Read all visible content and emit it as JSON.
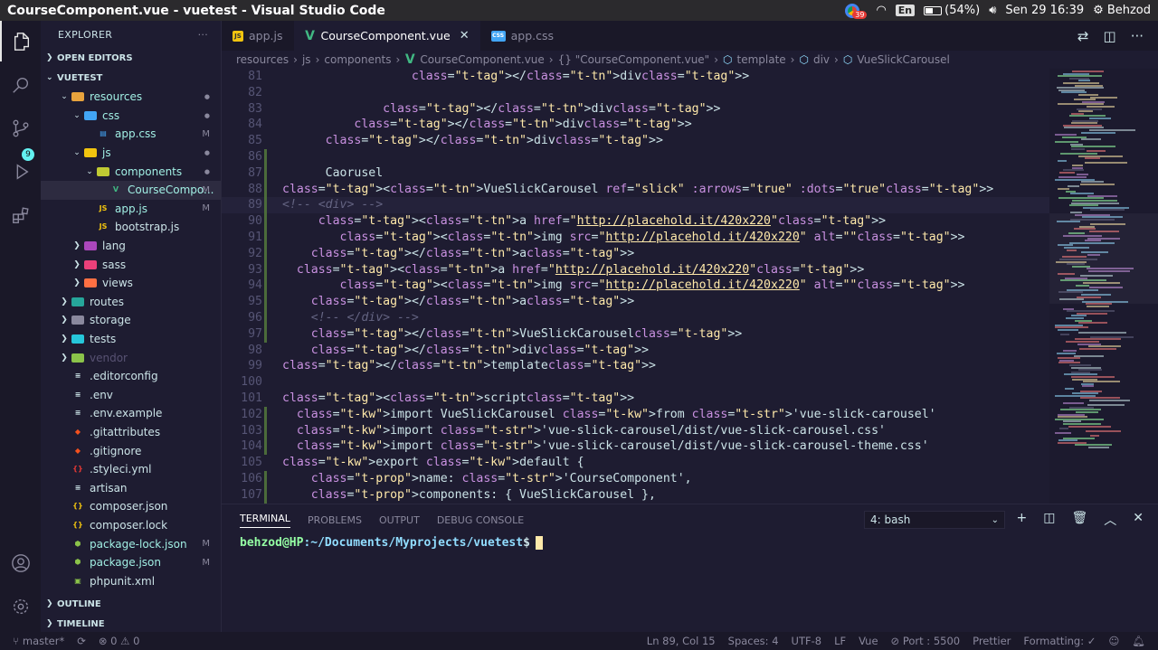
{
  "window": {
    "title": "CourseComponent.vue - vuetest - Visual Studio Code"
  },
  "system": {
    "notification_count": "39",
    "lang": "En",
    "battery": "(54%)",
    "battery_level": 0.54,
    "datetime": "Sen 29 16:39",
    "user": "Behzod"
  },
  "activity": {
    "scm_badge": "9"
  },
  "sidebar": {
    "header": "EXPLORER",
    "open_editors": "OPEN EDITORS",
    "project": "VUETEST",
    "outline": "OUTLINE",
    "timeline": "TIMELINE",
    "tree": [
      {
        "label": "resources",
        "depth": 1,
        "type": "folder-open",
        "status": "●"
      },
      {
        "label": "css",
        "depth": 2,
        "type": "folder-open",
        "status": "●"
      },
      {
        "label": "app.css",
        "depth": 3,
        "type": "css",
        "status": "M"
      },
      {
        "label": "js",
        "depth": 2,
        "type": "folder-open",
        "status": "●"
      },
      {
        "label": "components",
        "depth": 3,
        "type": "folder-open",
        "status": "●"
      },
      {
        "label": "CourseCompo...",
        "depth": 4,
        "type": "vue",
        "status": "M"
      },
      {
        "label": "app.js",
        "depth": 3,
        "type": "js",
        "status": "M"
      },
      {
        "label": "bootstrap.js",
        "depth": 3,
        "type": "js",
        "status": ""
      },
      {
        "label": "lang",
        "depth": 2,
        "type": "folder",
        "status": ""
      },
      {
        "label": "sass",
        "depth": 2,
        "type": "folder",
        "status": ""
      },
      {
        "label": "views",
        "depth": 2,
        "type": "folder",
        "status": ""
      },
      {
        "label": "routes",
        "depth": 1,
        "type": "folder",
        "status": ""
      },
      {
        "label": "storage",
        "depth": 1,
        "type": "folder",
        "status": ""
      },
      {
        "label": "tests",
        "depth": 1,
        "type": "folder",
        "status": ""
      },
      {
        "label": "vendor",
        "depth": 1,
        "type": "folder",
        "status": ""
      },
      {
        "label": ".editorconfig",
        "depth": 1,
        "type": "file",
        "status": ""
      },
      {
        "label": ".env",
        "depth": 1,
        "type": "file",
        "status": ""
      },
      {
        "label": ".env.example",
        "depth": 1,
        "type": "file",
        "status": ""
      },
      {
        "label": ".gitattributes",
        "depth": 1,
        "type": "git",
        "status": ""
      },
      {
        "label": ".gitignore",
        "depth": 1,
        "type": "git",
        "status": ""
      },
      {
        "label": ".styleci.yml",
        "depth": 1,
        "type": "yml",
        "status": ""
      },
      {
        "label": "artisan",
        "depth": 1,
        "type": "file",
        "status": ""
      },
      {
        "label": "composer.json",
        "depth": 1,
        "type": "json",
        "status": ""
      },
      {
        "label": "composer.lock",
        "depth": 1,
        "type": "json",
        "status": ""
      },
      {
        "label": "package-lock.json",
        "depth": 1,
        "type": "node",
        "status": "M"
      },
      {
        "label": "package.json",
        "depth": 1,
        "type": "node",
        "status": "M"
      },
      {
        "label": "phpunit.xml",
        "depth": 1,
        "type": "xml",
        "status": ""
      }
    ]
  },
  "tabs": [
    {
      "label": "app.js",
      "icon": "JS",
      "kind": "js",
      "active": false
    },
    {
      "label": "CourseComponent.vue",
      "icon": "V",
      "kind": "vue",
      "active": true
    },
    {
      "label": "app.css",
      "icon": "CSS",
      "kind": "css",
      "active": false
    }
  ],
  "breadcrumb": [
    "resources",
    "js",
    "components",
    "CourseComponent.vue",
    "{} \"CourseComponent.vue\"",
    "template",
    "div",
    "VueSlickCarousel"
  ],
  "code": {
    "current_line": 89,
    "lines": [
      {
        "n": 81,
        "m": false,
        "html": "                  </div>"
      },
      {
        "n": 82,
        "m": false,
        "html": ""
      },
      {
        "n": 83,
        "m": false,
        "html": "              </div>"
      },
      {
        "n": 84,
        "m": false,
        "html": "          </div>"
      },
      {
        "n": 85,
        "m": false,
        "html": "      </div>"
      },
      {
        "n": 86,
        "m": true,
        "html": ""
      },
      {
        "n": 87,
        "m": true,
        "html": "      Caorusel"
      },
      {
        "n": 88,
        "m": true,
        "html": "<VueSlickCarousel ref=\"slick\" :arrows=\"true\" :dots=\"true\">"
      },
      {
        "n": 89,
        "m": true,
        "html": "<!-- <div> -->"
      },
      {
        "n": 90,
        "m": true,
        "html": "     <a href=\"http://placehold.it/420x220\">"
      },
      {
        "n": 91,
        "m": true,
        "html": "        <img src=\"http://placehold.it/420x220\" alt=\"\">"
      },
      {
        "n": 92,
        "m": true,
        "html": "    </a>"
      },
      {
        "n": 93,
        "m": true,
        "html": "  <a href=\"http://placehold.it/420x220\">"
      },
      {
        "n": 94,
        "m": true,
        "html": "        <img src=\"http://placehold.it/420x220\" alt=\"\">"
      },
      {
        "n": 95,
        "m": true,
        "html": "    </a>"
      },
      {
        "n": 96,
        "m": true,
        "html": "    <!-- </div> -->"
      },
      {
        "n": 97,
        "m": true,
        "html": "    </VueSlickCarousel>"
      },
      {
        "n": 98,
        "m": false,
        "html": "    </div>"
      },
      {
        "n": 99,
        "m": false,
        "html": "</template>"
      },
      {
        "n": 100,
        "m": false,
        "html": ""
      },
      {
        "n": 101,
        "m": false,
        "html": "<script>"
      },
      {
        "n": 102,
        "m": true,
        "html": "  import VueSlickCarousel from 'vue-slick-carousel'"
      },
      {
        "n": 103,
        "m": true,
        "html": "  import 'vue-slick-carousel/dist/vue-slick-carousel.css'"
      },
      {
        "n": 104,
        "m": true,
        "html": "  import 'vue-slick-carousel/dist/vue-slick-carousel-theme.css'"
      },
      {
        "n": 105,
        "m": false,
        "html": "export default {"
      },
      {
        "n": 106,
        "m": true,
        "html": "    name: 'CourseComponent',"
      },
      {
        "n": 107,
        "m": true,
        "html": "    components: { VueSlickCarousel },"
      }
    ]
  },
  "panel": {
    "tabs": [
      "TERMINAL",
      "PROBLEMS",
      "OUTPUT",
      "DEBUG CONSOLE"
    ],
    "shell": "4: bash",
    "prompt_user": "behzod@HP",
    "prompt_path": ":~/Documents/Myprojects/vuetest",
    "prompt_sign": "$"
  },
  "status": {
    "branch": "master*",
    "problems": "⊗ 0 ⚠ 0",
    "position": "Ln 89, Col 15",
    "spaces": "Spaces: 4",
    "encoding": "UTF-8",
    "eol": "LF",
    "language": "Vue",
    "port": "⊘ Port : 5500",
    "prettier": "Prettier",
    "formatting": "Formatting: ✓"
  },
  "colors": {
    "accent": "#63f2f1",
    "bg": "#1e1c31",
    "vue": "#41b883",
    "js": "#f1c40f",
    "css": "#42a5f5"
  }
}
